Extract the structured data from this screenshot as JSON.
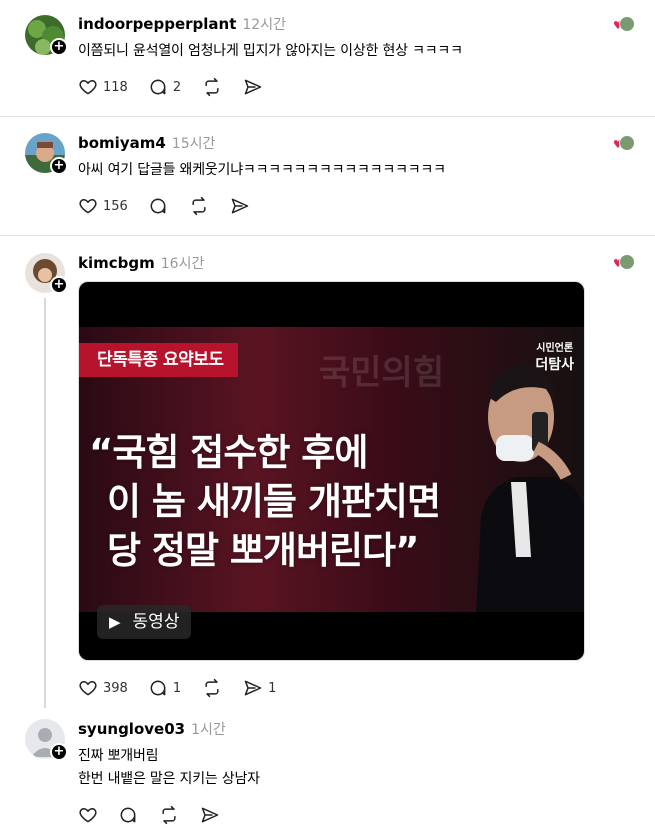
{
  "posts": [
    {
      "username": "indoorpepperplant",
      "time": "12시간",
      "lines": [
        "이쯤되니 윤석열이 엄청나게 밉지가 않아지는 이상한 현상 ㅋㅋㅋㅋ"
      ],
      "likes": "118",
      "replies": "2",
      "reposts": "",
      "shares": ""
    },
    {
      "username": "bomiyam4",
      "time": "15시간",
      "lines": [
        "아씨 여기 답글들 왜케웃기냐ㅋㅋㅋㅋㅋㅋㅋㅋㅋㅋㅋㅋㅋㅋㅋㅋ"
      ],
      "likes": "156",
      "replies": "",
      "reposts": "",
      "shares": ""
    },
    {
      "username": "kimcbgm",
      "time": "16시간",
      "lines": [],
      "likes": "398",
      "replies": "1",
      "reposts": "",
      "shares": "1",
      "media": {
        "tag": "단독특종 요약보도",
        "background_word": "국민의힘",
        "brand_line1": "시민언론",
        "brand_line2": "더탐사",
        "headline": [
          "“국힘 접수한 후에",
          "이 놈 새끼들 개판치면",
          "당 정말 뽀개버린다”"
        ],
        "video_label": "동영상"
      }
    },
    {
      "username": "syunglove03",
      "time": "1시간",
      "lines": [
        "진짜 뽀개버림",
        "한번 내뱉은 말은 지키는 상남자"
      ],
      "likes": "",
      "replies": "",
      "reposts": "",
      "shares": ""
    }
  ],
  "icons": {
    "like": "heart-outline-icon",
    "reply": "comment-bubble-icon",
    "repost": "repost-arrows-icon",
    "share": "send-paper-plane-icon",
    "follow": "plus-badge-icon",
    "reaction": "liked-by-avatar-icon"
  },
  "colors": {
    "divider": "#e2e2e2",
    "time": "#999999",
    "heart": "#e0245e",
    "tag_red": "#b8132d"
  }
}
